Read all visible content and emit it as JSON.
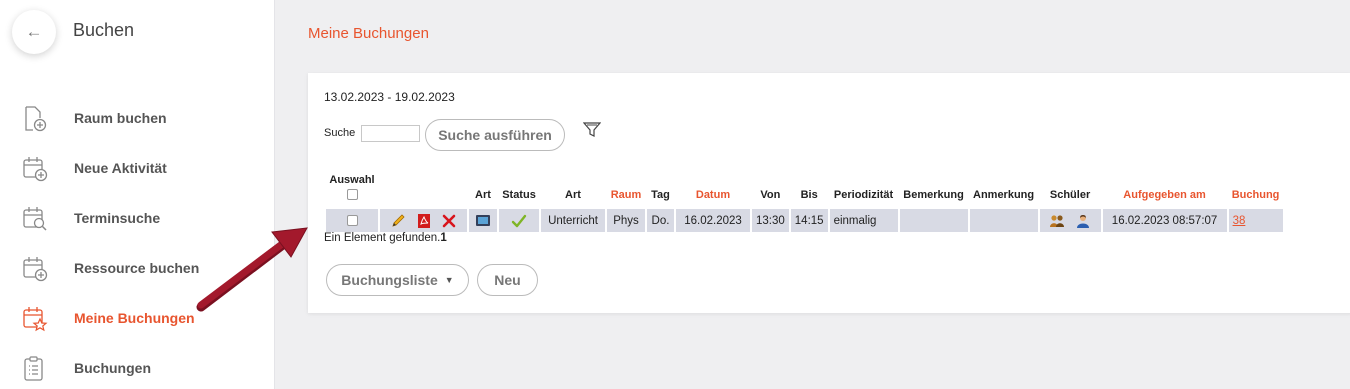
{
  "sidebar": {
    "back_icon": "←",
    "title": "Buchen",
    "items": [
      {
        "label": "Raum buchen",
        "icon": "file-plus-icon"
      },
      {
        "label": "Neue Aktivität",
        "icon": "calendar-plus-icon"
      },
      {
        "label": "Terminsuche",
        "icon": "calendar-search-icon"
      },
      {
        "label": "Ressource buchen",
        "icon": "calendar-plus-icon"
      },
      {
        "label": "Meine Buchungen",
        "icon": "calendar-star-icon",
        "active": true
      },
      {
        "label": "Buchungen",
        "icon": "clipboard-list-icon"
      }
    ]
  },
  "main": {
    "title": "Meine Buchungen",
    "date_range": "13.02.2023 - 19.02.2023",
    "search": {
      "label": "Suche",
      "value": "",
      "button": "Suche ausführen"
    },
    "table": {
      "headers": {
        "auswahl": "Auswahl",
        "art_icon": "Art",
        "status": "Status",
        "art": "Art",
        "raum": "Raum",
        "tag": "Tag",
        "datum": "Datum",
        "von": "Von",
        "bis": "Bis",
        "periodizitaet": "Periodizität",
        "bemerkung": "Bemerkung",
        "anmerkung": "Anmerkung",
        "schueler": "Schüler",
        "aufgegeben": "Aufgegeben am",
        "buchung": "Buchung"
      },
      "row": {
        "art": "Unterricht",
        "raum": "Phys",
        "tag": "Do.",
        "datum": "16.02.2023",
        "von": "13:30",
        "bis": "14:15",
        "periodizitaet": "einmalig",
        "bemerkung": "",
        "anmerkung": "",
        "aufgegeben": "16.02.2023 08:57:07",
        "buchung": "38"
      }
    },
    "found_text": "Ein Element gefunden.",
    "found_count": "1",
    "buttons": {
      "list": "Buchungsliste",
      "new": "Neu"
    }
  },
  "colors": {
    "accent": "#e8552f",
    "row_bg": "#d8dae4",
    "arrow": "#a3192c"
  }
}
